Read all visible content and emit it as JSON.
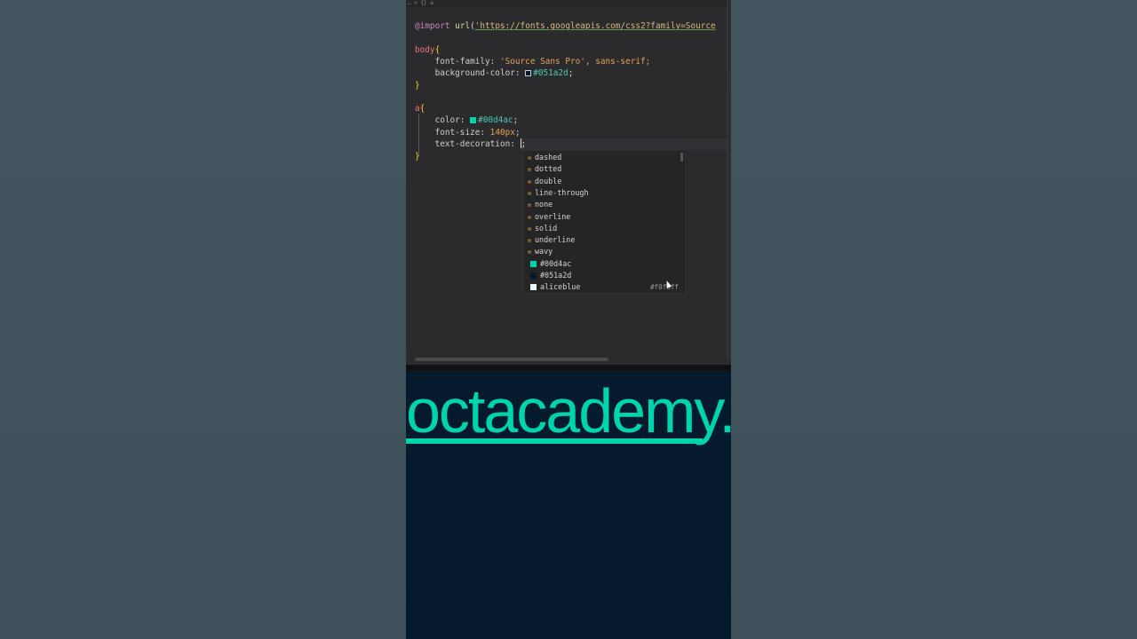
{
  "editor": {
    "breadcrumb": "…  >  {} a",
    "code": {
      "import_kw": "@import",
      "import_fn": "url(",
      "import_url": "'https://fonts.googleapis.com/css2?family=Source",
      "body_selector": "body",
      "open_brace": "{",
      "close_brace": "}",
      "ff_prop": "    font-family: ",
      "ff_val": "'Source Sans Pro', sans-serif;",
      "bg_prop": "    background-color: ",
      "bg_val": "#051a2d",
      "semi": ";",
      "a_selector": "a",
      "color_prop": "    color: ",
      "color_val": "#00d4ac",
      "fs_prop": "    font-size: ",
      "fs_val": "140px",
      "td_prop": "    text-decoration: "
    },
    "colors": {
      "accent": "#00d4ac",
      "background": "#051a2d",
      "aliceblue": "#f0f8ff"
    }
  },
  "suggestions": {
    "keyword_items": [
      "dashed",
      "dotted",
      "double",
      "line-through",
      "none",
      "overline",
      "solid",
      "underline",
      "wavy"
    ],
    "color_items": [
      {
        "label": "#00d4ac",
        "color": "#00d4ac",
        "detail": ""
      },
      {
        "label": "#051a2d",
        "color": "#051a2d",
        "detail": ""
      },
      {
        "label": "aliceblue",
        "color": "#f0f8ff",
        "detail": "#f0f8ff"
      }
    ],
    "keyword_icon": "wrench-icon"
  },
  "preview": {
    "link_text": "octacademy."
  }
}
